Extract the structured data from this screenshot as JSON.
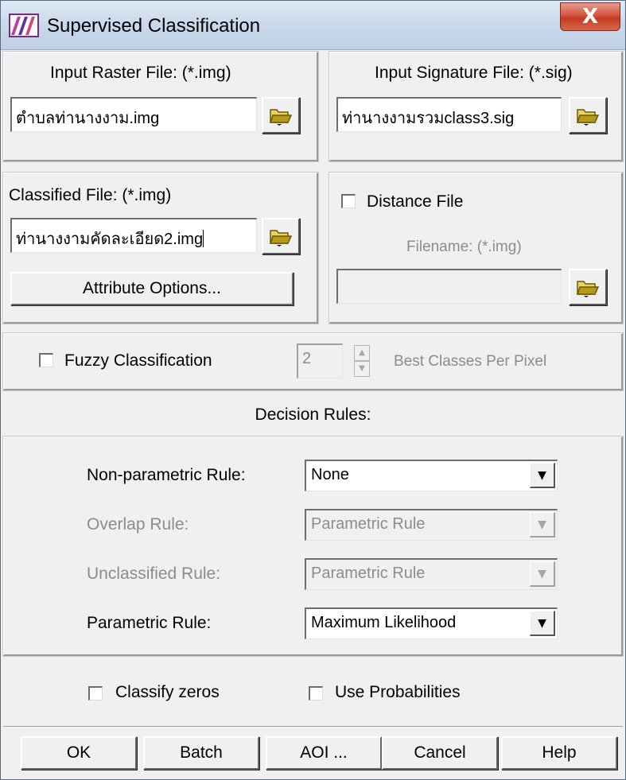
{
  "window": {
    "title": "Supervised Classification",
    "close_label": "X"
  },
  "input_raster": {
    "label": "Input Raster File: (*.img)",
    "value": "ตำบลท่านางงาม.img"
  },
  "input_signature": {
    "label": "Input Signature File: (*.sig)",
    "value": "ท่านางงามรวมclass3.sig"
  },
  "classified": {
    "label": "Classified File: (*.img)",
    "value": "ท่านางงามคัดละเอียด2.img",
    "attribute_button": "Attribute Options..."
  },
  "distance": {
    "label": "Distance File",
    "filename_label": "Filename: (*.img)",
    "value": ""
  },
  "fuzzy": {
    "label": "Fuzzy Classification",
    "spin_value": "2",
    "suffix": "Best Classes Per Pixel"
  },
  "decision_rules": {
    "header": "Decision Rules:",
    "non_parametric": {
      "label": "Non-parametric Rule:",
      "value": "None"
    },
    "overlap": {
      "label": "Overlap Rule:",
      "value": "Parametric Rule"
    },
    "unclassified": {
      "label": "Unclassified Rule:",
      "value": "Parametric Rule"
    },
    "parametric": {
      "label": "Parametric Rule:",
      "value": "Maximum Likelihood"
    },
    "classify_zeros": "Classify zeros",
    "use_probabilities": "Use Probabilities"
  },
  "buttons": {
    "ok": "OK",
    "batch": "Batch",
    "aoi": "AOI ...",
    "cancel": "Cancel",
    "help": "Help"
  },
  "icons": {
    "app": "classification-app-icon",
    "folder": "folder-open-icon",
    "dropdown": "chevron-down-icon"
  }
}
